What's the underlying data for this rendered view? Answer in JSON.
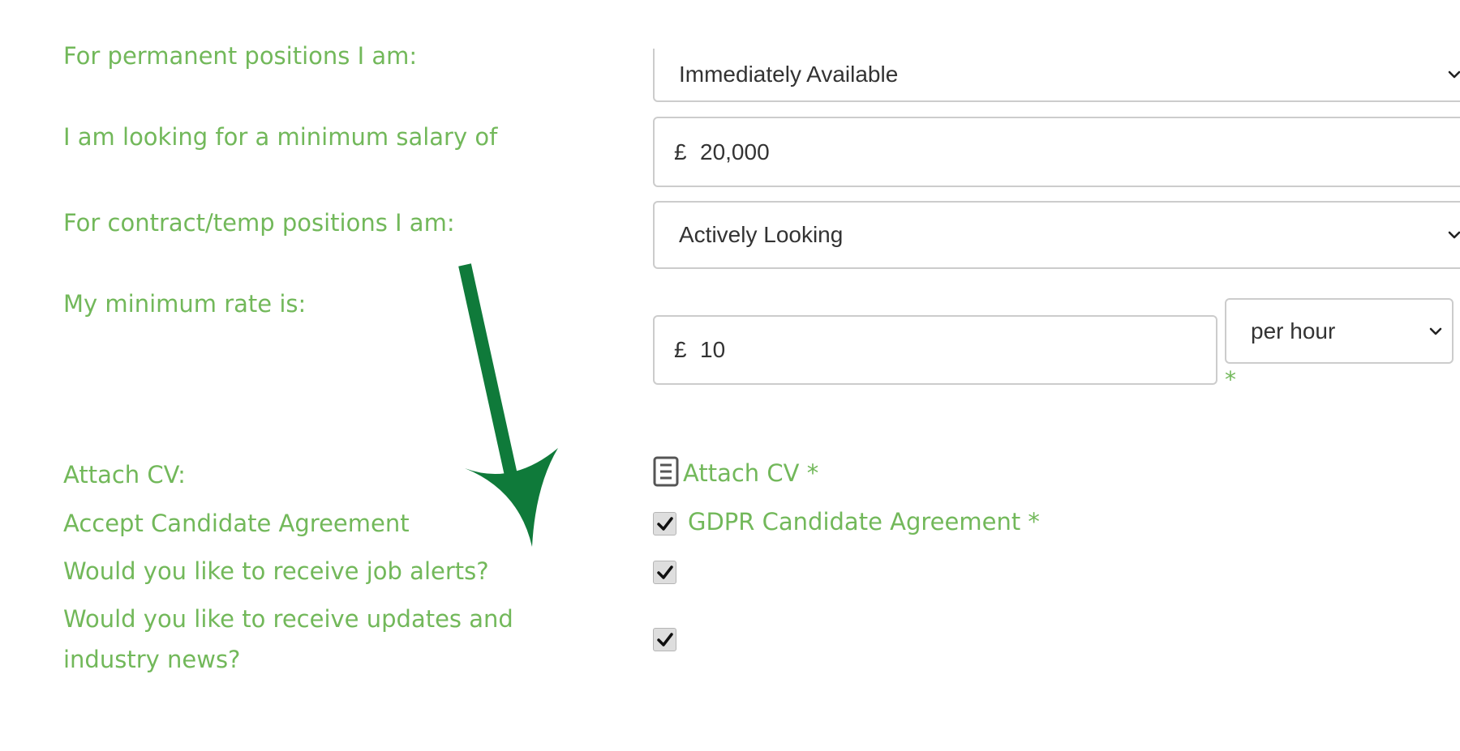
{
  "form": {
    "permanent": {
      "label": "For permanent positions I am:",
      "value": "Immediately Available"
    },
    "salary": {
      "label": "I am looking for a minimum salary of",
      "currency": "£",
      "value": "20,000"
    },
    "contract": {
      "label": "For contract/temp positions I am:",
      "value": "Actively Looking"
    },
    "rate": {
      "label": "My minimum rate is:",
      "currency": "£",
      "value": "10",
      "period": "per hour",
      "required": "*"
    },
    "cv": {
      "label": "Attach CV:",
      "link": "Attach CV",
      "required": "*"
    },
    "agreement": {
      "label": "Accept Candidate Agreement",
      "link": "GDPR Candidate Agreement",
      "required": "*",
      "checked": true
    },
    "job_alerts": {
      "label": "Would you like to receive job alerts?",
      "checked": true
    },
    "updates": {
      "label": "Would you like to receive updates and industry news?",
      "checked": true
    }
  },
  "annotation": {
    "arrow_color": "#0f7a3a"
  },
  "colors": {
    "label_green": "#72b85a",
    "border": "#cccccc",
    "text": "#333333"
  },
  "icons": [
    "chevron-down-icon",
    "document-icon",
    "checkmark-icon",
    "annotation-arrow"
  ]
}
